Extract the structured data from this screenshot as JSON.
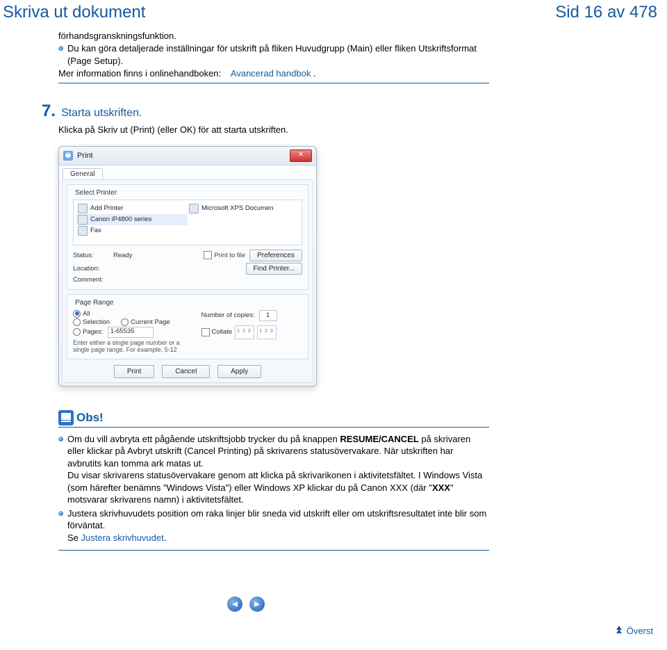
{
  "header": {
    "title": "Skriva ut dokument",
    "page_label": "Sid 16 av 478"
  },
  "intro": {
    "line1": "förhandsgranskningsfunktion.",
    "bullet2": "Du kan göra detaljerade inställningar för utskrift på fliken Huvudgrupp (Main) eller fliken Utskriftsformat (Page Setup).",
    "more_info_prefix": "Mer information finns i onlinehandboken:",
    "more_info_link": "Avancerad handbok",
    "more_info_suffix": "."
  },
  "step7": {
    "number": "7.",
    "title": "Starta utskriften.",
    "body": "Klicka på Skriv ut (Print) (eller OK) för att starta utskriften."
  },
  "dialog": {
    "title": "Print",
    "close": "✕",
    "tab": "General",
    "select_printer_label": "Select Printer",
    "printers": {
      "add": "Add Printer",
      "canon": "Canon iP4800 series",
      "fax": "Fax",
      "xps": "Microsoft XPS Documen"
    },
    "status_label": "Status:",
    "status_value": "Ready",
    "location_label": "Location:",
    "comment_label": "Comment:",
    "print_to_file": "Print to file",
    "preferences": "Preferences",
    "find_printer": "Find Printer...",
    "page_range_label": "Page Range",
    "all": "All",
    "selection": "Selection",
    "current_page": "Current Page",
    "pages": "Pages:",
    "pages_value": "1-65535",
    "pages_hint": "Enter either a single page number or a single page range. For example, 5-12",
    "copies_label": "Number of copies:",
    "copies_value": "1",
    "collate": "Collate",
    "print_btn": "Print",
    "cancel_btn": "Cancel",
    "apply_btn": "Apply"
  },
  "obs": {
    "heading": "Obs!",
    "b1_a": "Om du vill avbryta ett pågående utskriftsjobb trycker du på knappen ",
    "resume_cancel": "RESUME/CANCEL",
    "b1_b": " på skrivaren eller klickar på Avbryt utskrift (Cancel Printing) på skrivarens statusövervakare. När utskriften har avbrutits kan tomma ark matas ut.",
    "b1_c": "Du visar skrivarens statusövervakare genom att klicka på skrivarikonen i aktivitetsfältet. I Windows Vista (som härefter benämns \"Windows Vista\") eller Windows XP klickar du på Canon XXX (där ",
    "xxx_a": "\"",
    "xxx": "XXX",
    "xxx_b": "\"",
    "b1_d": " motsvarar skrivarens namn) i aktivitetsfältet.",
    "b2": "Justera skrivhuvudets position om raka linjer blir sneda vid utskrift eller om utskriftsresultatet inte blir som förväntat.",
    "b2_see": "Se ",
    "b2_link": "Justera skrivhuvudet",
    "b2_dot": "."
  },
  "nav": {
    "prev": "◄",
    "next": "►",
    "top": "Överst"
  }
}
